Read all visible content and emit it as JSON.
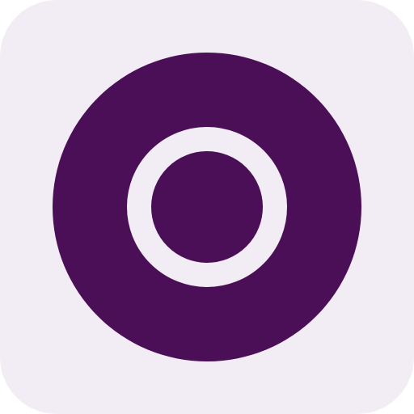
{
  "app_icon": {
    "icon": "target-ring-icon",
    "colors": {
      "background": "#f2edf4",
      "primary": "#4a0f57",
      "ring": "#f2edf4"
    }
  }
}
